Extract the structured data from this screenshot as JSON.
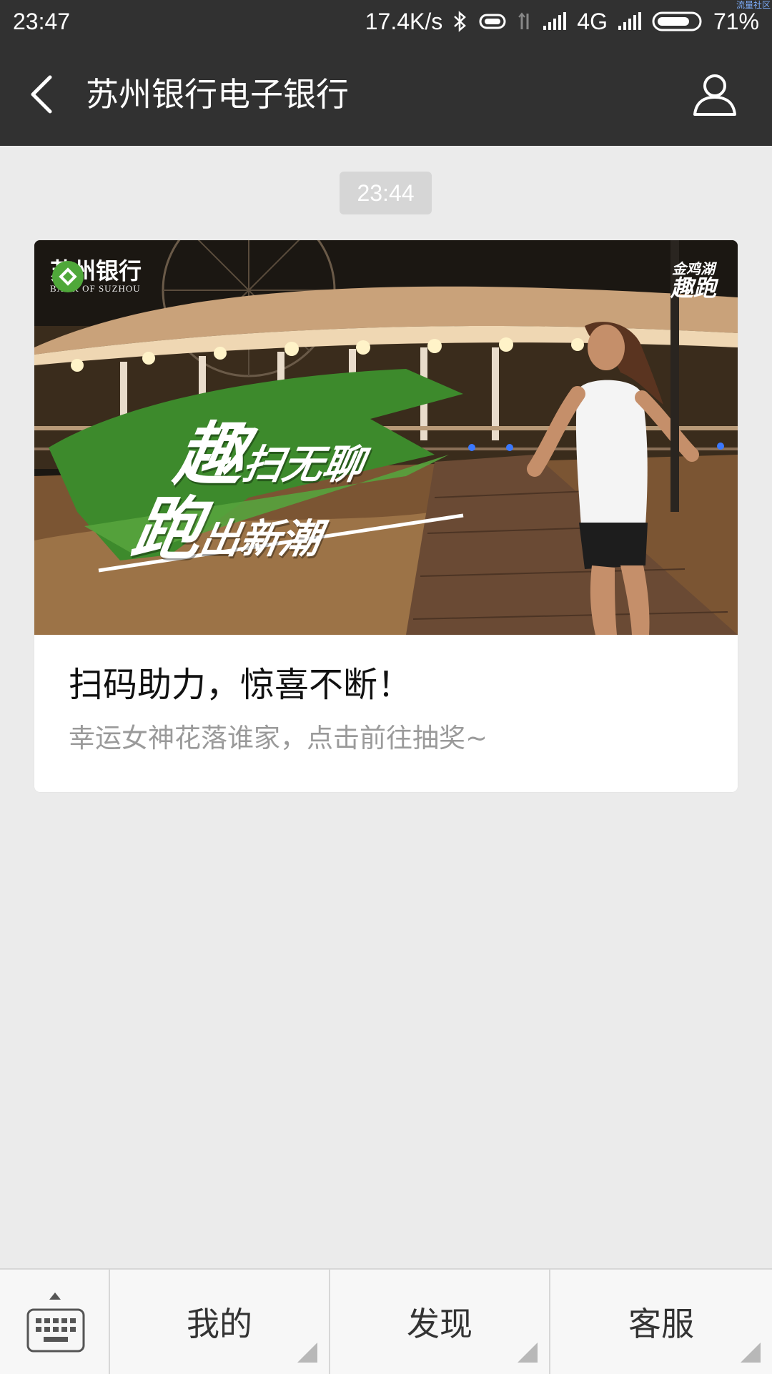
{
  "status_bar": {
    "time": "23:47",
    "network_speed": "17.4K/s",
    "network_type": "4G",
    "battery": "71%",
    "watermark": "流量社区",
    "icons": [
      "bluetooth-icon",
      "vibrate-icon",
      "data-arrows-icon",
      "signal-icon",
      "signal-icon-2",
      "battery-icon"
    ]
  },
  "header": {
    "back_icon": "chevron-left-icon",
    "title": "苏州银行电子银行",
    "profile_icon": "person-icon"
  },
  "chat": {
    "timestamp": "23:44",
    "article": {
      "banner": {
        "logo_name": "苏州银行",
        "logo_en": "BANK OF SUZHOU",
        "badge_line1": "金鸡湖",
        "badge_line2": "趣跑",
        "slogan_line1_big": "趣",
        "slogan_line1_small": "扫无聊",
        "slogan_line2_big": "跑",
        "slogan_line2_small": "出新潮"
      },
      "title": "扫码助力，惊喜不断！",
      "description": "幸运女神花落谁家，点击前往抽奖~"
    }
  },
  "bottom_menu": {
    "keyboard_icon": "keyboard-icon",
    "items": [
      {
        "label": "我的"
      },
      {
        "label": "发现"
      },
      {
        "label": "客服"
      }
    ]
  },
  "colors": {
    "bar_dark": "#313131",
    "chat_bg": "#ebebeb",
    "banner_green": "#3d8a2c",
    "menu_bg": "#f7f7f7"
  }
}
